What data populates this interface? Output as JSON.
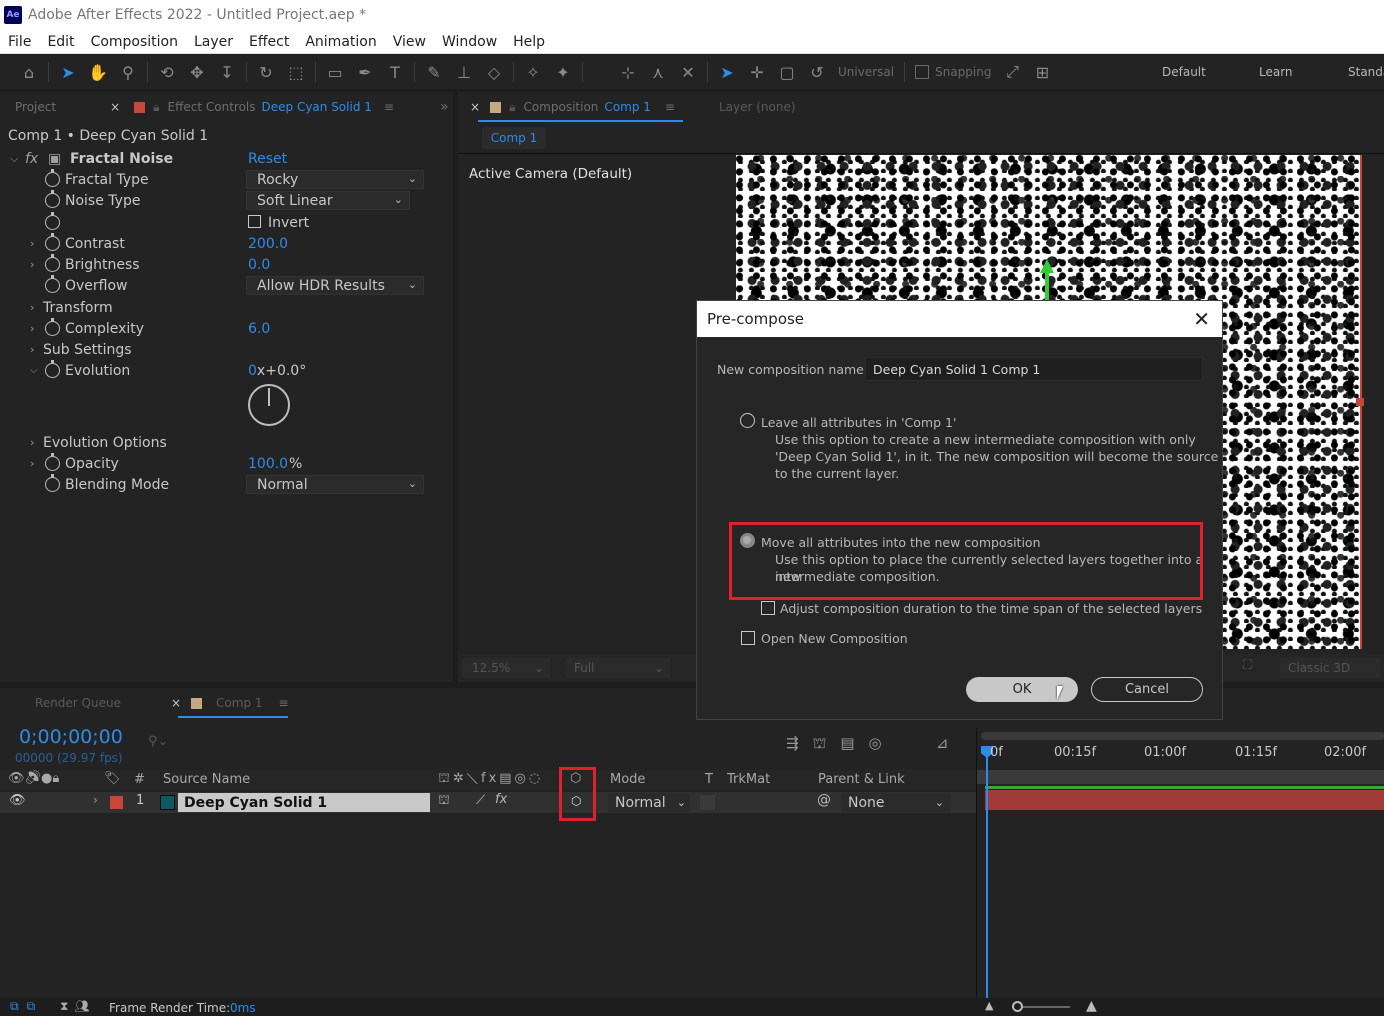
{
  "window": {
    "title": "Adobe After Effects 2022 - Untitled Project.aep *",
    "logo": "Ae"
  },
  "menu": [
    "File",
    "Edit",
    "Composition",
    "Layer",
    "Effect",
    "Animation",
    "View",
    "Window",
    "Help"
  ],
  "toolbar": {
    "universal": "Universal",
    "snapping": "Snapping"
  },
  "workspaces": [
    "Default",
    "Learn",
    "Standa"
  ],
  "left_panel": {
    "tab_project": "Project",
    "tab_effect_controls": "Effect Controls",
    "tab_effect_target": "Deep Cyan Solid 1",
    "breadcrumb": "Comp 1 • Deep Cyan Solid 1",
    "effect_name": "Fractal Noise",
    "reset": "Reset",
    "props": {
      "fractal_type": {
        "label": "Fractal Type",
        "value": "Rocky"
      },
      "noise_type": {
        "label": "Noise Type",
        "value": "Soft Linear"
      },
      "invert": {
        "label": "Invert"
      },
      "contrast": {
        "label": "Contrast",
        "value": "200.0"
      },
      "brightness": {
        "label": "Brightness",
        "value": "0.0"
      },
      "overflow": {
        "label": "Overflow",
        "value": "Allow HDR Results"
      },
      "transform": {
        "label": "Transform"
      },
      "complexity": {
        "label": "Complexity",
        "value": "6.0"
      },
      "sub_settings": {
        "label": "Sub Settings"
      },
      "evolution": {
        "label": "Evolution",
        "value_rev": "0",
        "value_deg": "x+0.0°"
      },
      "evolution_options": {
        "label": "Evolution Options"
      },
      "opacity": {
        "label": "Opacity",
        "value": "100.0",
        "unit": "%"
      },
      "blending_mode": {
        "label": "Blending Mode",
        "value": "Normal"
      }
    }
  },
  "comp_panel": {
    "tab_label": "Composition",
    "tab_comp": "Comp 1",
    "layer_tab": "Layer (none)",
    "sub_tab": "Comp 1",
    "camera": "Active Camera (Default)",
    "zoom": "12.5%",
    "resolution": "Full",
    "renderer": "Classic 3D"
  },
  "dialog": {
    "title": "Pre-compose",
    "name_label": "New composition name:",
    "name_value": "Deep Cyan Solid 1 Comp 1",
    "opt1_title": "Leave all attributes in 'Comp 1'",
    "opt1_line1": "Use this option to create a new intermediate composition with only",
    "opt1_line2": "'Deep Cyan Solid 1', in it. The new composition will become the source",
    "opt1_line3": "to the current layer.",
    "opt2_title": "Move all attributes into the new composition",
    "opt2_line1": "Use this option to place the currently selected layers together into a new",
    "opt2_line2": "intermediate composition.",
    "adjust_label": "Adjust composition duration to the time span of the selected layers",
    "open_label": "Open New Composition",
    "ok": "OK",
    "cancel": "Cancel"
  },
  "timeline": {
    "tab_render_queue": "Render Queue",
    "tab_comp": "Comp 1",
    "timecode": "0;00;00;00",
    "frames": "00000 (29.97 fps)",
    "col_num": "#",
    "col_source": "Source Name",
    "col_mode": "Mode",
    "col_t": "T",
    "col_trkmat": "TrkMat",
    "col_parent": "Parent & Link",
    "layer": {
      "num": "1",
      "name": "Deep Cyan Solid 1",
      "mode": "Normal",
      "parent": "None"
    },
    "ruler": [
      "0f",
      "00:15f",
      "01:00f",
      "01:15f",
      "02:00f"
    ],
    "footer_label": "Frame Render Time:",
    "footer_value": "0ms"
  },
  "colors": {
    "accent": "#2d8ceb",
    "highlight": "#e0202a",
    "layer_label": "#c8463a",
    "solid_swatch": "#0d5a60",
    "comp_swatch": "#c8a882"
  }
}
